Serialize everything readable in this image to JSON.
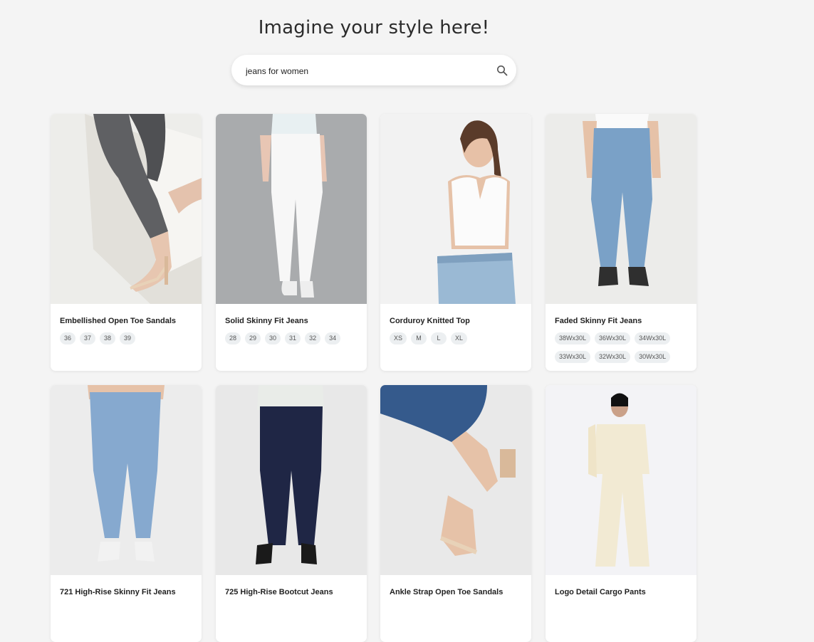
{
  "header": {
    "title": "Imagine your style here!"
  },
  "search": {
    "value": "jeans for women",
    "placeholder": "Search"
  },
  "products": [
    {
      "title": "Embellished Open Toe Sandals",
      "sizes": [
        "36",
        "37",
        "38",
        "39"
      ]
    },
    {
      "title": "Solid Skinny Fit Jeans",
      "sizes": [
        "28",
        "29",
        "30",
        "31",
        "32",
        "34"
      ]
    },
    {
      "title": "Corduroy Knitted Top",
      "sizes": [
        "XS",
        "M",
        "L",
        "XL"
      ]
    },
    {
      "title": "Faded Skinny Fit Jeans",
      "sizes": [
        "38Wx30L",
        "36Wx30L",
        "34Wx30L",
        "33Wx30L",
        "32Wx30L",
        "30Wx30L"
      ]
    },
    {
      "title": "721 High-Rise Skinny Fit Jeans",
      "sizes": []
    },
    {
      "title": "725 High-Rise Bootcut Jeans",
      "sizes": []
    },
    {
      "title": "Ankle Strap Open Toe Sandals",
      "sizes": []
    },
    {
      "title": "Logo Detail Cargo Pants",
      "sizes": []
    }
  ]
}
